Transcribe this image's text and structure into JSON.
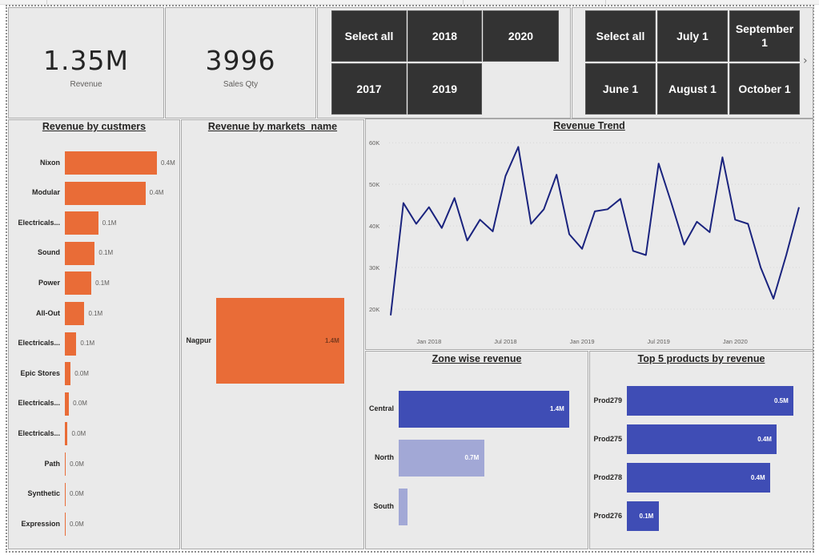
{
  "cards": [
    {
      "value": "1.35M",
      "label": "Revenue"
    },
    {
      "value": "3996",
      "label": "Sales Qty"
    }
  ],
  "year_slicer": {
    "buttons": [
      "Select all",
      "2018",
      "2020",
      "2017",
      "2019"
    ]
  },
  "date_slicer": {
    "buttons": [
      "Select all",
      "July 1",
      "September 1",
      "June 1",
      "August 1",
      "October 1"
    ],
    "next_icon": "chevron-right-icon"
  },
  "colors": {
    "orange": "#e96c37",
    "blue": "#3f4db5",
    "light_blue": "#a2a8d6",
    "line": "#1a237e"
  },
  "chart_data": [
    {
      "type": "bar",
      "orientation": "horizontal",
      "title": "Revenue by custmers",
      "categories": [
        "Nixon",
        "Modular",
        "Electricals...",
        "Sound",
        "Power",
        "All-Out",
        "Electricals...",
        "Epic Stores",
        "Electricals...",
        "Electricals...",
        "Path",
        "Synthetic",
        "Expression"
      ],
      "values": [
        0.4,
        0.35,
        0.145,
        0.13,
        0.115,
        0.085,
        0.05,
        0.025,
        0.018,
        0.012,
        0.004,
        0.003,
        0.002
      ],
      "value_labels": [
        "0.4M",
        "0.4M",
        "0.1M",
        "0.1M",
        "0.1M",
        "0.1M",
        "0.1M",
        "0.0M",
        "0.0M",
        "0.0M",
        "0.0M",
        "0.0M",
        "0.0M"
      ],
      "max": 0.4
    },
    {
      "type": "bar",
      "orientation": "horizontal",
      "title": "Revenue by markets_name",
      "categories": [
        "Nagpur"
      ],
      "values": [
        1.4
      ],
      "value_labels": [
        "1.4M"
      ],
      "max": 1.4
    },
    {
      "type": "line",
      "title": "Revenue Trend",
      "x_ticks": [
        "Jan 2018",
        "Jul 2018",
        "Jan 2019",
        "Jul 2019",
        "Jan 2020"
      ],
      "y_ticks": [
        "20K",
        "30K",
        "40K",
        "50K",
        "60K"
      ],
      "ylim": [
        17500,
        61000
      ],
      "x_start": "2017-10",
      "values": [
        18500,
        45500,
        40500,
        44500,
        39500,
        46700,
        36500,
        41500,
        38700,
        52000,
        59000,
        40500,
        44000,
        52300,
        38000,
        34500,
        43500,
        44000,
        46500,
        34000,
        33000,
        55000,
        45500,
        35500,
        41000,
        38500,
        56500,
        41500,
        40500,
        30000,
        22500,
        33000,
        44500
      ]
    },
    {
      "type": "bar",
      "orientation": "horizontal",
      "title": "Zone wise revenue",
      "categories": [
        "Central",
        "North",
        "South"
      ],
      "values": [
        1.4,
        0.7,
        0.07
      ],
      "value_labels": [
        "1.4M",
        "0.7M",
        ""
      ],
      "max": 1.4
    },
    {
      "type": "bar",
      "orientation": "horizontal",
      "title": "Top 5 products by revenue",
      "categories": [
        "Prod279",
        "Prod275",
        "Prod278",
        "Prod276"
      ],
      "values": [
        0.5,
        0.45,
        0.43,
        0.095
      ],
      "value_labels": [
        "0.5M",
        "0.4M",
        "0.4M",
        "0.1M"
      ],
      "max": 0.5
    }
  ]
}
